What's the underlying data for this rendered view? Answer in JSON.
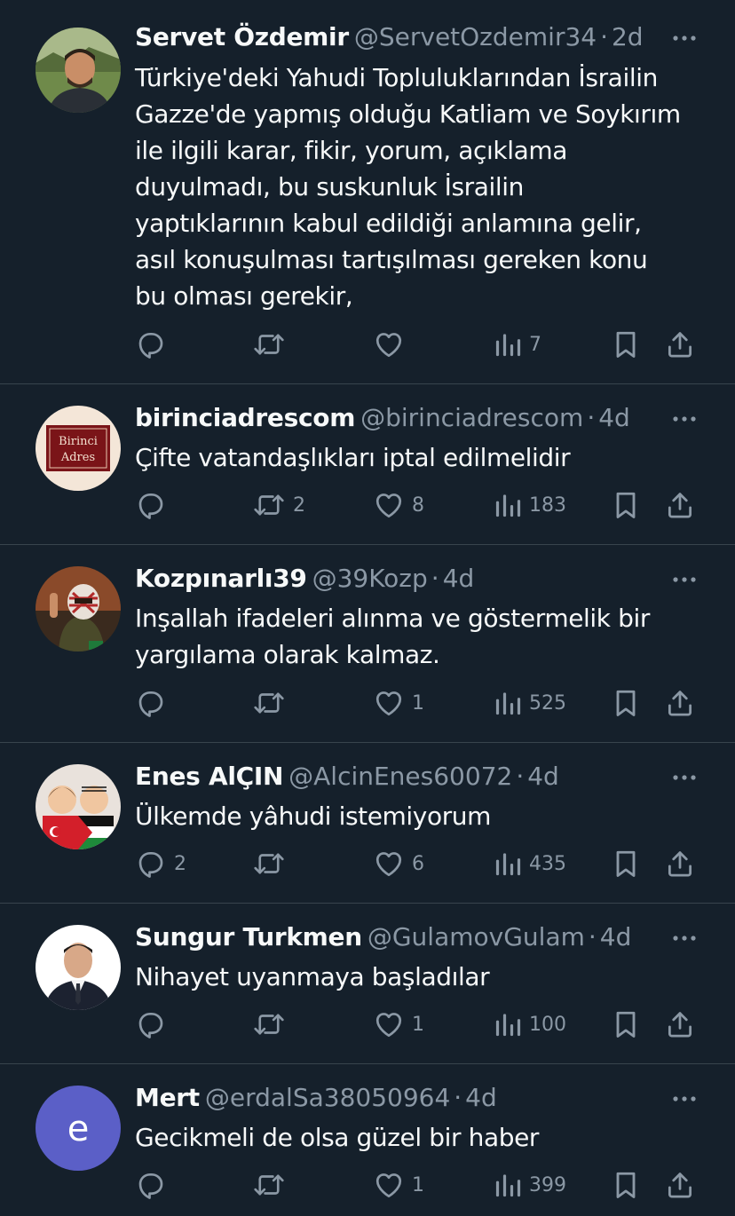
{
  "colors": {
    "background": "#15202b",
    "text": "#f7f9f9",
    "muted": "#8b98a5",
    "divider": "#38444d"
  },
  "tweets": [
    {
      "name": "Servet Özdemir",
      "handle": "@ServetOzdemir34",
      "dot": "·",
      "time": "2d",
      "avatar": "profile-photo-man",
      "lines": [
        "Türkiye'deki Yahudi Topluluklarından İsrailin",
        "Gazze'de yapmış olduğu Katliam ve Soykırım",
        "ile ilgili karar, fikir, yorum, açıklama",
        "duyulmadı, bu suskunluk İsrailin",
        "yaptıklarının kabul edildiği anlamına gelir,",
        "asıl konuşulması tartışılması gereken konu",
        "bu olması gerekir,"
      ],
      "replies": "",
      "retweets": "",
      "likes": "",
      "views": "7"
    },
    {
      "name": "birinciadrescom",
      "handle": "@birinciadrescom",
      "dot": "·",
      "time": "4d",
      "avatar": "birinci-adres-logo",
      "logo_text": [
        "Birinci",
        "Adres"
      ],
      "lines": [
        "Çifte vatandaşlıkları iptal edilmelidir"
      ],
      "replies": "",
      "retweets": "2",
      "likes": "8",
      "views": "183"
    },
    {
      "name": "Kozpınarlı39",
      "handle": "@39Kozp",
      "dot": "·",
      "time": "4d",
      "avatar": "masked-figure-photo",
      "lines": [
        "Inşallah ifadeleri alınma ve göstermelik bir",
        "yargılama olarak kalmaz."
      ],
      "replies": "",
      "retweets": "",
      "likes": "1",
      "views": "525"
    },
    {
      "name": "Enes AlÇIN",
      "handle": "@AlcinEnes60072",
      "dot": "·",
      "time": "4d",
      "avatar": "two-children-flags",
      "lines": [
        "Ülkemde yâhudi istemiyorum"
      ],
      "replies": "2",
      "retweets": "",
      "likes": "6",
      "views": "435"
    },
    {
      "name": "Sungur Turkmen",
      "handle": "@GulamovGulam",
      "dot": "·",
      "time": "4d",
      "avatar": "suit-portrait",
      "lines": [
        "Nihayet uyanmaya başladılar"
      ],
      "replies": "",
      "retweets": "",
      "likes": "1",
      "views": "100"
    },
    {
      "name": "Mert",
      "handle": "@erdalSa38050964",
      "dot": "·",
      "time": "4d",
      "avatar": "letter-avatar",
      "avatar_letter": "e",
      "lines": [
        "Gecikmeli de olsa güzel bir haber"
      ],
      "replies": "",
      "retweets": "",
      "likes": "1",
      "views": "399"
    }
  ]
}
